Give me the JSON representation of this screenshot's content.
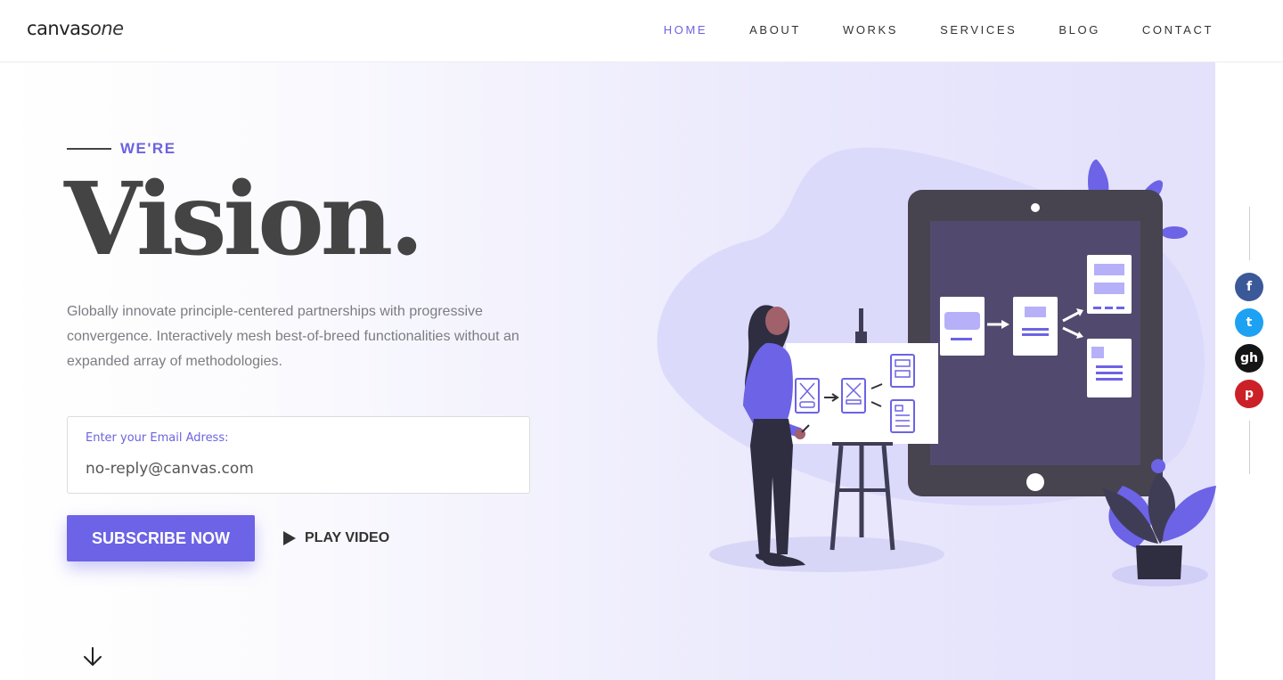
{
  "header": {
    "logo_bold": "canvas",
    "logo_italic": "one",
    "nav": [
      {
        "label": "HOME",
        "active": true
      },
      {
        "label": "ABOUT"
      },
      {
        "label": "WORKS"
      },
      {
        "label": "SERVICES"
      },
      {
        "label": "BLOG"
      },
      {
        "label": "CONTACT"
      }
    ]
  },
  "hero": {
    "eyebrow": "WE'RE",
    "title": "Vision.",
    "description": "Globally innovate principle-centered partnerships with progressive convergence. Interactively mesh best-of-breed functionalities without an expanded array of methodologies.",
    "email_label": "Enter your Email Adress:",
    "email_value": "no-reply@canvas.com",
    "subscribe_label": "SUBSCRIBE NOW",
    "play_label": "PLAY VIDEO"
  },
  "social": [
    {
      "name": "facebook",
      "glyph": "f"
    },
    {
      "name": "twitter",
      "glyph": "t"
    },
    {
      "name": "github",
      "glyph": "gh"
    },
    {
      "name": "pinterest",
      "glyph": "p"
    }
  ],
  "colors": {
    "accent": "#6c63e6",
    "text_dark": "#444444",
    "facebook": "#3b5998",
    "twitter": "#1da1f2",
    "github": "#151515",
    "pinterest": "#cb2027"
  }
}
